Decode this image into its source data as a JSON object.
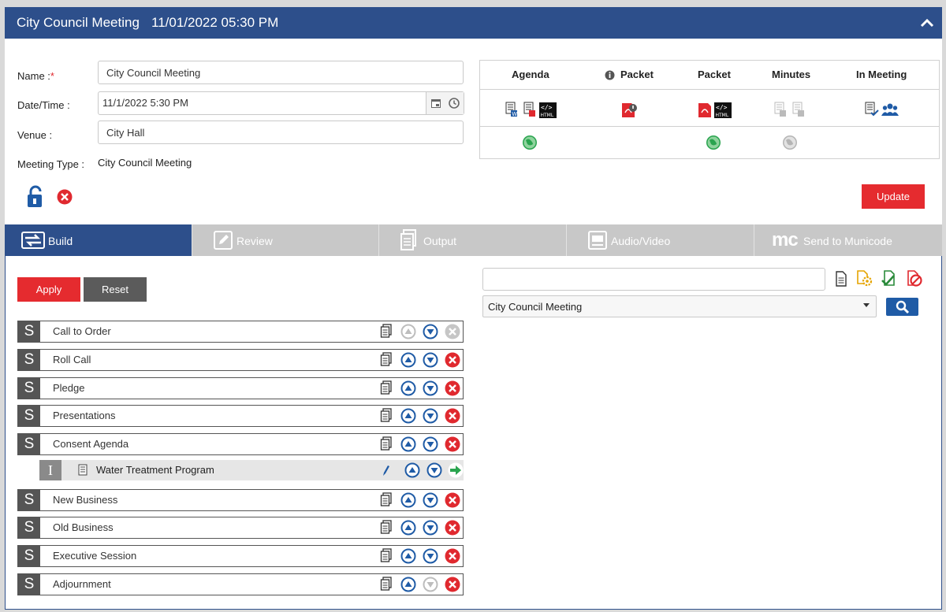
{
  "header": {
    "title": "City Council Meeting",
    "datetime": "11/01/2022 05:30 PM"
  },
  "form": {
    "name_label": "Name :",
    "required_mark": "*",
    "name_value": "City Council Meeting",
    "datetime_label": "Date/Time :",
    "datetime_value": "11/1/2022 5:30 PM",
    "venue_label": "Venue :",
    "venue_value": "City Hall",
    "type_label": "Meeting Type :",
    "type_value": "City Council Meeting"
  },
  "publish": {
    "columns": [
      "Agenda",
      "Packet",
      "Packet",
      "Minutes",
      "In Meeting"
    ]
  },
  "update_label": "Update",
  "tabs": [
    {
      "label": "Build"
    },
    {
      "label": "Review"
    },
    {
      "label": "Output"
    },
    {
      "label": "Audio/Video"
    },
    {
      "label": "Send to Municode",
      "logo": "mc"
    }
  ],
  "build": {
    "apply_label": "Apply",
    "reset_label": "Reset",
    "section_marker": "S",
    "item_marker": "I",
    "sections": [
      {
        "label": "Call to Order"
      },
      {
        "label": "Roll Call"
      },
      {
        "label": "Pledge"
      },
      {
        "label": "Presentations"
      },
      {
        "label": "Consent Agenda"
      },
      {
        "label": "New Business"
      },
      {
        "label": "Old Business"
      },
      {
        "label": "Executive Session"
      },
      {
        "label": "Adjournment"
      }
    ],
    "item": {
      "label": "Water Treatment Program"
    }
  },
  "search": {
    "input_value": "",
    "select_value": "City Council Meeting"
  },
  "colors": {
    "brand": "#2d4f8b",
    "danger": "#e52b2f",
    "up": "#1f5ba6",
    "green": "#2aa44f"
  }
}
